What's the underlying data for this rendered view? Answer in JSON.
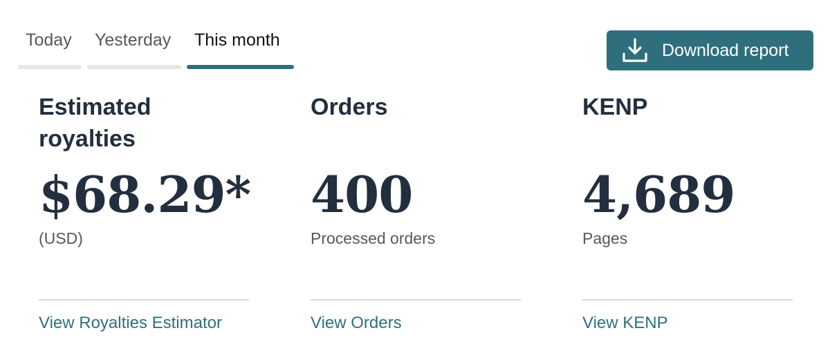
{
  "tabs": [
    {
      "label": "Today",
      "active": false
    },
    {
      "label": "Yesterday",
      "active": false
    },
    {
      "label": "This month",
      "active": true
    }
  ],
  "download": {
    "label": "Download report",
    "icon": "download-icon",
    "color": "#2f6f7d"
  },
  "metrics": {
    "royalties": {
      "title": "Estimated royalties",
      "value": "$68.29*",
      "sub": "(USD)",
      "link": "View Royalties Estimator"
    },
    "orders": {
      "title": "Orders",
      "value": "400",
      "sub": "Processed orders",
      "link": "View Orders"
    },
    "kenp": {
      "title": "KENP",
      "value": "4,689",
      "sub": "Pages",
      "link": "View KENP"
    }
  },
  "colors": {
    "accent": "#2f6f7d",
    "text_dark": "#232f3e",
    "text_muted": "#565959",
    "tab_inactive_bar": "#e6e6e6"
  }
}
